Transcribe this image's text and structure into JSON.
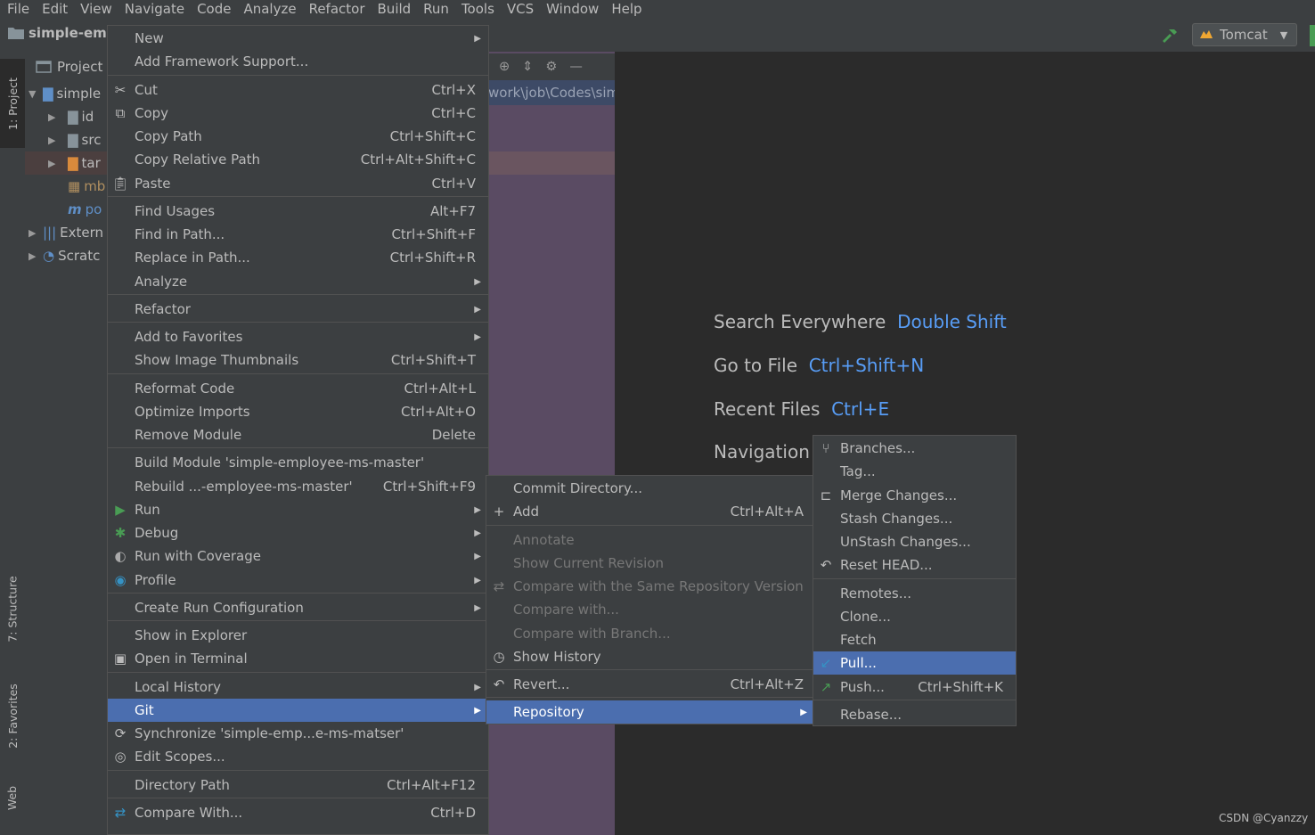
{
  "menubar": [
    "File",
    "Edit",
    "View",
    "Navigate",
    "Code",
    "Analyze",
    "Refactor",
    "Build",
    "Run",
    "Tools",
    "VCS",
    "Window",
    "Help"
  ],
  "navbar": {
    "project": "simple-emp",
    "run_config": "Tomcat"
  },
  "left_strip": {
    "project_tab": "1: Project",
    "structure_tab": "7: Structure",
    "favorites_tab": "2: Favorites",
    "web_tab": "Web"
  },
  "project_panel": {
    "title": "Project",
    "rows": [
      "simple",
      "id",
      "src",
      "tar",
      "mb",
      "po",
      "Extern",
      "Scratc"
    ]
  },
  "mid_panel": {
    "path": "work\\job\\Codes\\sim"
  },
  "editor_hints": [
    {
      "label": "Search Everywhere",
      "key": "Double Shift"
    },
    {
      "label": "Go to File",
      "key": "Ctrl+Shift+N"
    },
    {
      "label": "Recent Files",
      "key": "Ctrl+E"
    },
    {
      "label": "Navigation",
      "key": ""
    }
  ],
  "context_menu": [
    {
      "label": "New",
      "shortcut": "",
      "submenu": true
    },
    {
      "label": "Add Framework Support...",
      "shortcut": ""
    },
    {
      "label": "Cut",
      "shortcut": "Ctrl+X",
      "icon": "scissors-icon"
    },
    {
      "label": "Copy",
      "shortcut": "Ctrl+C",
      "icon": "copy-icon"
    },
    {
      "label": "Copy Path",
      "shortcut": "Ctrl+Shift+C"
    },
    {
      "label": "Copy Relative Path",
      "shortcut": "Ctrl+Alt+Shift+C"
    },
    {
      "label": "Paste",
      "shortcut": "Ctrl+V",
      "icon": "paste-icon"
    },
    {
      "label": "Find Usages",
      "shortcut": "Alt+F7"
    },
    {
      "label": "Find in Path...",
      "shortcut": "Ctrl+Shift+F"
    },
    {
      "label": "Replace in Path...",
      "shortcut": "Ctrl+Shift+R"
    },
    {
      "label": "Analyze",
      "shortcut": "",
      "submenu": true
    },
    {
      "label": "Refactor",
      "shortcut": "",
      "submenu": true
    },
    {
      "label": "Add to Favorites",
      "shortcut": "",
      "submenu": true
    },
    {
      "label": "Show Image Thumbnails",
      "shortcut": "Ctrl+Shift+T"
    },
    {
      "label": "Reformat Code",
      "shortcut": "Ctrl+Alt+L"
    },
    {
      "label": "Optimize Imports",
      "shortcut": "Ctrl+Alt+O"
    },
    {
      "label": "Remove Module",
      "shortcut": "Delete"
    },
    {
      "label": "Build Module 'simple-employee-ms-master'",
      "shortcut": ""
    },
    {
      "label": "Rebuild ...-employee-ms-master'",
      "shortcut": "Ctrl+Shift+F9"
    },
    {
      "label": "Run",
      "shortcut": "",
      "submenu": true,
      "icon": "run-icon"
    },
    {
      "label": "Debug",
      "shortcut": "",
      "submenu": true,
      "icon": "debug-icon"
    },
    {
      "label": "Run with Coverage",
      "shortcut": "",
      "submenu": true,
      "icon": "coverage-icon"
    },
    {
      "label": "Profile",
      "shortcut": "",
      "submenu": true,
      "icon": "profile-icon"
    },
    {
      "label": "Create Run Configuration",
      "shortcut": "",
      "submenu": true
    },
    {
      "label": "Show in Explorer",
      "shortcut": ""
    },
    {
      "label": "Open in Terminal",
      "shortcut": "",
      "icon": "terminal-icon"
    },
    {
      "label": "Local History",
      "shortcut": "",
      "submenu": true
    },
    {
      "label": "Git",
      "shortcut": "",
      "submenu": true
    },
    {
      "label": "Synchronize 'simple-emp...e-ms-matser'",
      "shortcut": "",
      "icon": "sync-icon"
    },
    {
      "label": "Edit Scopes...",
      "shortcut": "",
      "icon": "scopes-icon"
    },
    {
      "label": "Directory Path",
      "shortcut": "Ctrl+Alt+F12"
    },
    {
      "label": "Compare With...",
      "shortcut": "Ctrl+D",
      "icon": "compare-icon"
    }
  ],
  "git_menu": [
    {
      "label": "Commit Directory...",
      "shortcut": ""
    },
    {
      "label": "Add",
      "shortcut": "Ctrl+Alt+A",
      "icon": "plus-icon"
    },
    {
      "label": "Annotate",
      "shortcut": "",
      "disabled": true
    },
    {
      "label": "Show Current Revision",
      "shortcut": "",
      "disabled": true
    },
    {
      "label": "Compare with the Same Repository Version",
      "shortcut": "",
      "disabled": true,
      "icon": "compare-icon"
    },
    {
      "label": "Compare with...",
      "shortcut": "",
      "disabled": true
    },
    {
      "label": "Compare with Branch...",
      "shortcut": "",
      "disabled": true
    },
    {
      "label": "Show History",
      "shortcut": "",
      "icon": "clock-icon"
    },
    {
      "label": "Revert...",
      "shortcut": "Ctrl+Alt+Z",
      "icon": "revert-icon"
    },
    {
      "label": "Repository",
      "shortcut": "",
      "submenu": true
    }
  ],
  "repo_menu": [
    {
      "label": "Branches...",
      "shortcut": "",
      "icon": "branch-icon"
    },
    {
      "label": "Tag...",
      "shortcut": ""
    },
    {
      "label": "Merge Changes...",
      "shortcut": "",
      "icon": "merge-icon"
    },
    {
      "label": "Stash Changes...",
      "shortcut": ""
    },
    {
      "label": "UnStash Changes...",
      "shortcut": ""
    },
    {
      "label": "Reset HEAD...",
      "shortcut": "",
      "icon": "reset-icon"
    },
    {
      "label": "Remotes...",
      "shortcut": ""
    },
    {
      "label": "Clone...",
      "shortcut": ""
    },
    {
      "label": "Fetch",
      "shortcut": ""
    },
    {
      "label": "Pull...",
      "shortcut": "",
      "icon": "pull-icon"
    },
    {
      "label": "Push...",
      "shortcut": "Ctrl+Shift+K",
      "icon": "push-icon"
    },
    {
      "label": "Rebase...",
      "shortcut": ""
    }
  ],
  "watermark": "CSDN @Cyanzzy"
}
